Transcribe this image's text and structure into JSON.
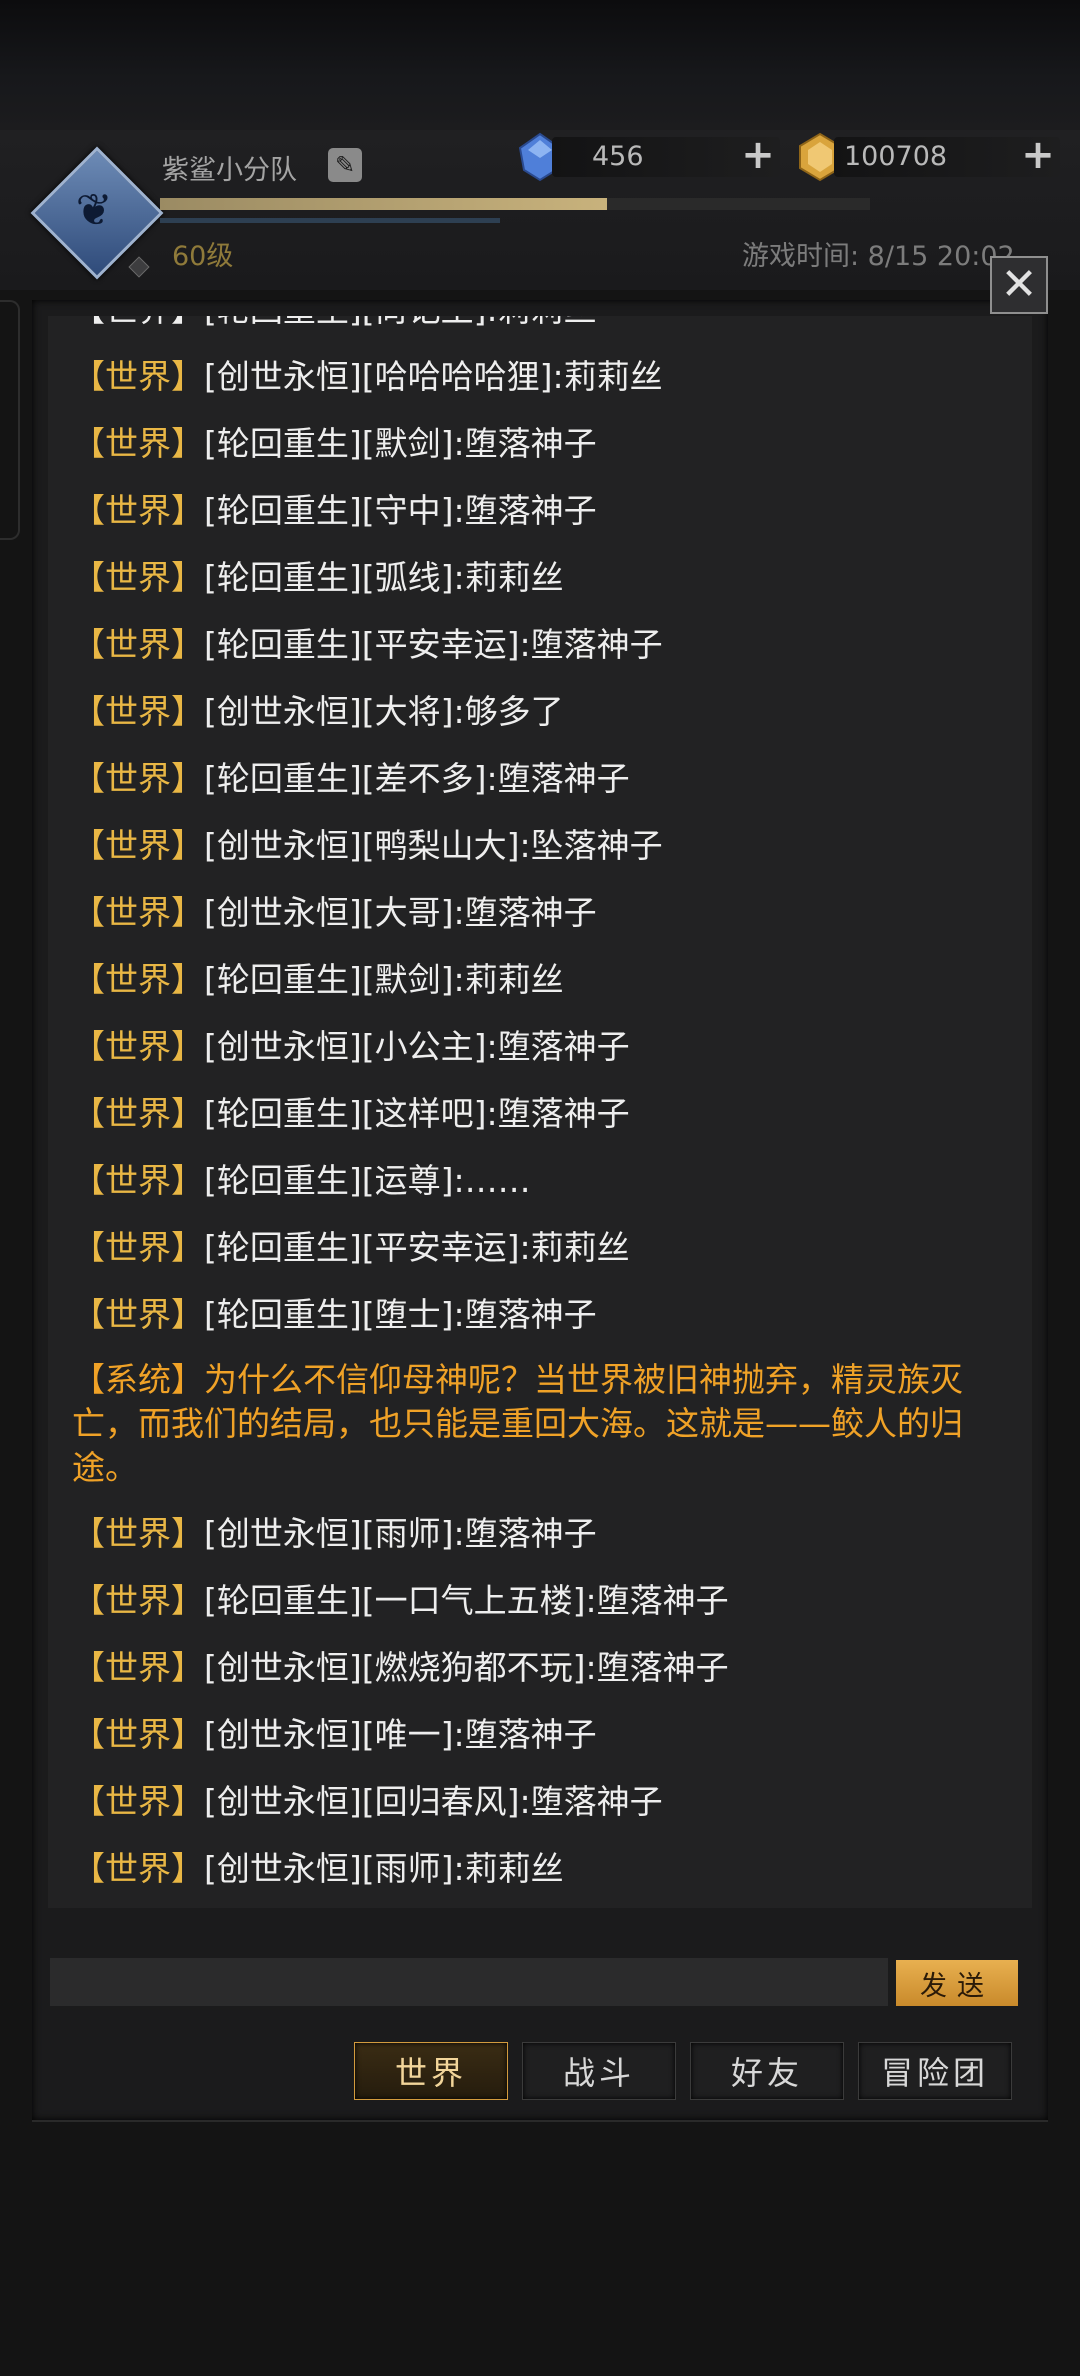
{
  "header": {
    "team_name": "紫鲨小分队",
    "level": "60级",
    "game_time": "游戏时间: 8/15 20:02",
    "xp_fraction": 0.63
  },
  "resources": {
    "gems": "456",
    "gold": "100708"
  },
  "icons": {
    "emblem": "team-emblem-icon",
    "edit": "edit-icon",
    "gem": "blue-gem-icon",
    "gold": "gold-coin-icon",
    "plus": "plus-icon",
    "close": "close-icon"
  },
  "colors": {
    "channel": "#e9b745",
    "system": "#f0a227",
    "accent": "#d39b3d"
  },
  "chat": {
    "partial_top": "【世界】[轮回重生][尚记王]:莉莉丝",
    "messages": [
      {
        "channel": "【世界】",
        "text": "[创世永恒][哈哈哈哈狸]:莉莉丝"
      },
      {
        "channel": "【世界】",
        "text": "[轮回重生][默剑]:堕落神子"
      },
      {
        "channel": "【世界】",
        "text": "[轮回重生][守中]:堕落神子"
      },
      {
        "channel": "【世界】",
        "text": "[轮回重生][弧线]:莉莉丝"
      },
      {
        "channel": "【世界】",
        "text": "[轮回重生][平安幸运]:堕落神子"
      },
      {
        "channel": "【世界】",
        "text": "[创世永恒][大将]:够多了"
      },
      {
        "channel": "【世界】",
        "text": "[轮回重生][差不多]:堕落神子"
      },
      {
        "channel": "【世界】",
        "text": "[创世永恒][鸭梨山大]:坠落神子"
      },
      {
        "channel": "【世界】",
        "text": "[创世永恒][大哥]:堕落神子"
      },
      {
        "channel": "【世界】",
        "text": "[轮回重生][默剑]:莉莉丝"
      },
      {
        "channel": "【世界】",
        "text": "[创世永恒][小公主]:堕落神子"
      },
      {
        "channel": "【世界】",
        "text": "[轮回重生][这样吧]:堕落神子"
      },
      {
        "channel": "【世界】",
        "text": "[轮回重生][运尊]:……"
      },
      {
        "channel": "【世界】",
        "text": "[轮回重生][平安幸运]:莉莉丝"
      },
      {
        "channel": "【世界】",
        "text": "[轮回重生][堕士]:堕落神子"
      }
    ],
    "system_message": "【系统】为什么不信仰母神呢？当世界被旧神抛弃，精灵族灭亡，而我们的结局，也只能是重回大海。这就是——鲛人的归途。",
    "messages_after": [
      {
        "channel": "【世界】",
        "text": "[创世永恒][雨师]:堕落神子"
      },
      {
        "channel": "【世界】",
        "text": "[轮回重生][一口气上五楼]:堕落神子"
      },
      {
        "channel": "【世界】",
        "text": "[创世永恒][燃烧狗都不玩]:堕落神子"
      },
      {
        "channel": "【世界】",
        "text": "[创世永恒][唯一]:堕落神子"
      },
      {
        "channel": "【世界】",
        "text": "[创世永恒][回归春风]:堕落神子"
      },
      {
        "channel": "【世界】",
        "text": "[创世永恒][雨师]:莉莉丝"
      }
    ]
  },
  "input": {
    "value": "",
    "send_label": "发送"
  },
  "tabs": [
    {
      "label": "世界",
      "active": true
    },
    {
      "label": "战斗",
      "active": false
    },
    {
      "label": "好友",
      "active": false
    },
    {
      "label": "冒险团",
      "active": false
    }
  ]
}
